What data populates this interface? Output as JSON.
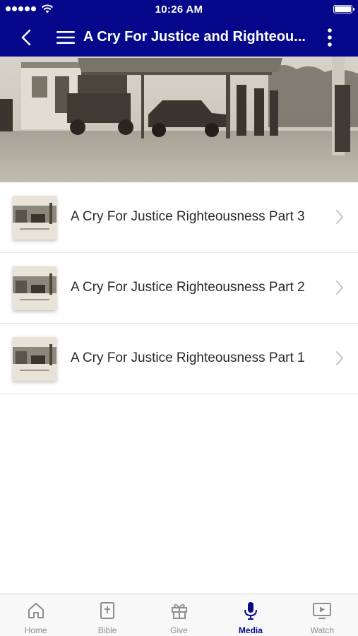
{
  "status_bar": {
    "time": "10:26 AM"
  },
  "nav": {
    "title": "A Cry For Justice and Righteou..."
  },
  "hero": {
    "icon": "historic-gas-station-photo"
  },
  "list": {
    "items": [
      {
        "title": "A Cry For Justice Righteousness Part 3"
      },
      {
        "title": "A Cry For Justice Righteousness Part 2"
      },
      {
        "title": "A Cry For Justice Righteousness Part 1"
      }
    ]
  },
  "tabs": [
    {
      "label": "Home",
      "icon": "home-icon"
    },
    {
      "label": "Bible",
      "icon": "bible-icon"
    },
    {
      "label": "Give",
      "icon": "gift-icon"
    },
    {
      "label": "Media",
      "icon": "microphone-icon",
      "active": true
    },
    {
      "label": "Watch",
      "icon": "tv-play-icon"
    }
  ],
  "colors": {
    "brand": "#05088a",
    "tab_inactive": "#8e8e8e",
    "tab_active": "#05088a"
  }
}
